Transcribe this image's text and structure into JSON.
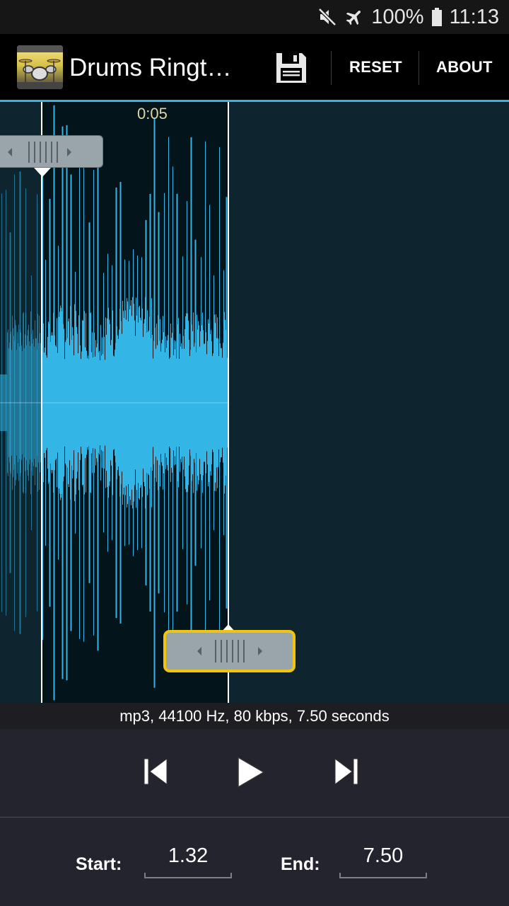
{
  "status_bar": {
    "battery_text": "100%",
    "time": "11:13",
    "icons": [
      "mute-icon",
      "airplane-mode-icon",
      "battery-icon"
    ]
  },
  "action_bar": {
    "title": "Drums Ringt…",
    "reset_label": "RESET",
    "about_label": "ABOUT",
    "icons": [
      "app-drums-icon",
      "save-icon"
    ]
  },
  "waveform": {
    "time_marker": "0:05",
    "colors": {
      "wave": "#33b5e5",
      "background": "#0e2530",
      "selection": "#04141b",
      "focused_handle_border": "#f1c40f"
    }
  },
  "info": {
    "text": "mp3, 44100 Hz, 80 kbps, 7.50 seconds"
  },
  "transport": {
    "icons": [
      "skip-previous-icon",
      "play-icon",
      "skip-next-icon"
    ]
  },
  "times": {
    "start_label": "Start:",
    "start_value": "1.32",
    "end_label": "End:",
    "end_value": "7.50"
  }
}
